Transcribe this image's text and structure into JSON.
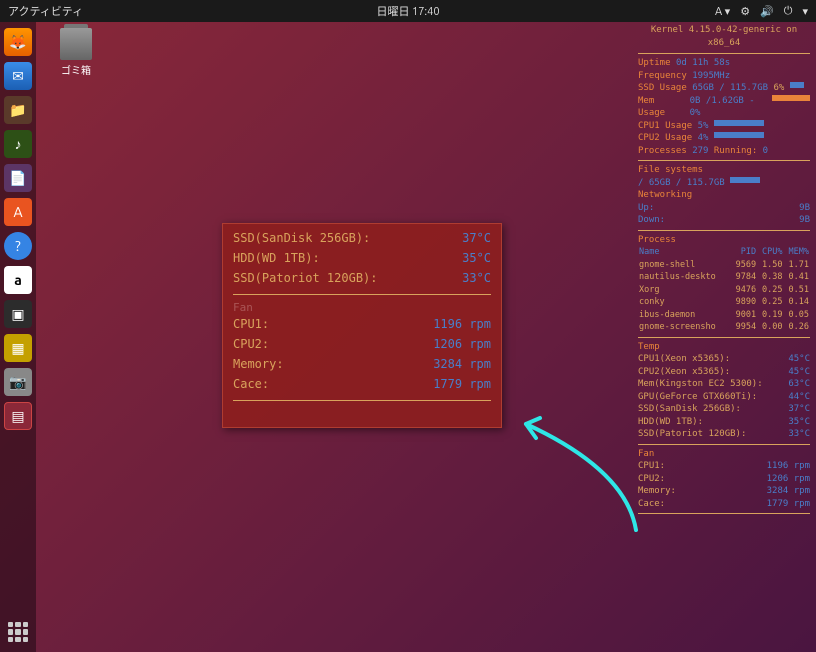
{
  "topbar": {
    "activities": "アクティビティ",
    "datetime": "日曜日 17:40",
    "lang": "A ▾"
  },
  "desktop": {
    "trash_label": "ゴミ箱"
  },
  "popup": {
    "temp_rows": [
      {
        "label": "SSD(SanDisk 256GB):",
        "value": "37°C"
      },
      {
        "label": "HDD(WD 1TB):",
        "value": "35°C"
      },
      {
        "label": "SSD(Patoriot 120GB):",
        "value": "33°C"
      }
    ],
    "fan_section": "Fan",
    "fan_rows": [
      {
        "label": "CPU1:",
        "value": "1196 rpm"
      },
      {
        "label": "CPU2:",
        "value": "1206 rpm"
      },
      {
        "label": "Memory:",
        "value": "3284 rpm"
      },
      {
        "label": "Cace:",
        "value": "1779 rpm"
      }
    ]
  },
  "side": {
    "kernel": "Kernel 4.15.0-42-generic on x86_64",
    "uptime_label": "Uptime",
    "uptime_val": "0d 11h 58s",
    "freq_label": "Frequency",
    "freq_val": "1995MHz",
    "ssd_label": "SSD Usage",
    "ssd_val": "65GB / 115.7GB",
    "ssd_pct": "6%",
    "mem_label": "Mem Usage",
    "mem_val": "0B  /1.62GB - 0%",
    "cpu1_label": "CPU1 Usage",
    "cpu1_val": "5%",
    "cpu2_label": "CPU2 Usage",
    "cpu2_val": "4%",
    "proc_label": "Processes",
    "proc_val": "279",
    "proc_run_label": "Running:",
    "proc_run": "0",
    "fs_title": "File systems",
    "fs_row": "/   65GB / 115.7GB",
    "net_title": "Networking",
    "net_up": "Up:",
    "net_up_val": "9B",
    "net_down": "Down:",
    "net_down_val": "9B",
    "proc_title": "Process",
    "proc_headers": [
      "Name",
      "PID",
      "CPU%",
      "MEM%"
    ],
    "processes": [
      [
        "gnome-shell",
        "9569",
        "1.50",
        "1.71"
      ],
      [
        "nautilus-deskto",
        "9784",
        "0.38",
        "0.41"
      ],
      [
        "Xorg",
        "9476",
        "0.25",
        "0.51"
      ],
      [
        "conky",
        "9890",
        "0.25",
        "0.14"
      ],
      [
        "ibus-daemon",
        "9001",
        "0.19",
        "0.05"
      ],
      [
        "gnome-screensho",
        "9954",
        "0.00",
        "0.26"
      ]
    ],
    "temp_title": "Temp",
    "temps": [
      [
        "CPU1(Xeon x5365):",
        "45°C"
      ],
      [
        "CPU2(Xeon x5365):",
        "45°C"
      ],
      [
        "Mem(Kingston EC2 5300):",
        "63°C"
      ],
      [
        "GPU(GeForce GTX660Ti):",
        "44°C"
      ],
      [
        "SSD(SanDisk 256GB):",
        "37°C"
      ],
      [
        "HDD(WD 1TB):",
        "35°C"
      ],
      [
        "SSD(Patoriot 120GB):",
        "33°C"
      ]
    ],
    "fan_title": "Fan",
    "fans": [
      [
        "CPU1:",
        "1196 rpm"
      ],
      [
        "CPU2:",
        "1206 rpm"
      ],
      [
        "Memory:",
        "3284 rpm"
      ],
      [
        "Cace:",
        "1779 rpm"
      ]
    ]
  }
}
